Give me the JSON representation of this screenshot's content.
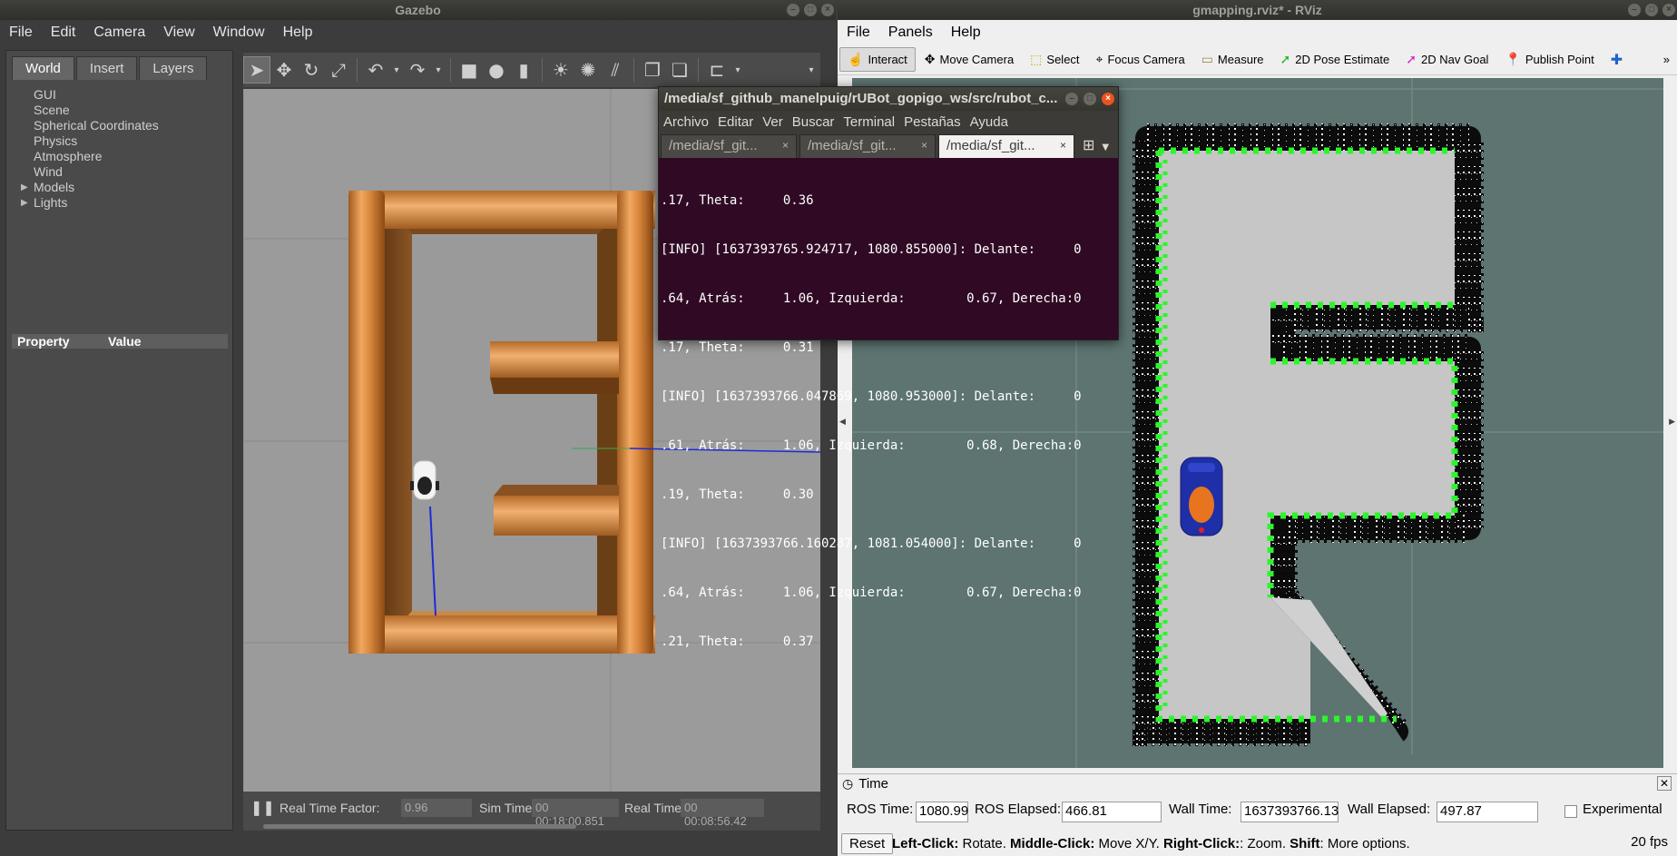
{
  "gazebo": {
    "title": "Gazebo",
    "menu": [
      "File",
      "Edit",
      "Camera",
      "View",
      "Window",
      "Help"
    ],
    "tabs": [
      "World",
      "Insert",
      "Layers"
    ],
    "tree": [
      "GUI",
      "Scene",
      "Spherical Coordinates",
      "Physics",
      "Atmosphere",
      "Wind",
      "Models",
      "Lights"
    ],
    "property_header": [
      "Property",
      "Value"
    ],
    "bottom": {
      "rtf_label": "Real Time Factor:",
      "rtf_value": "0.96",
      "sim_label": "Sim Time:",
      "sim_value": "00 00:18:00.851",
      "real_label": "Real Time:",
      "real_value": "00 00:08:56.42"
    }
  },
  "rviz": {
    "title": "gmapping.rviz* - RViz",
    "menu": [
      "File",
      "Panels",
      "Help"
    ],
    "tools": [
      {
        "label": "Interact",
        "icon": "hand-icon"
      },
      {
        "label": "Move Camera",
        "icon": "move-camera-icon"
      },
      {
        "label": "Select",
        "icon": "select-box-icon"
      },
      {
        "label": "Focus Camera",
        "icon": "focus-camera-icon"
      },
      {
        "label": "Measure",
        "icon": "ruler-icon"
      },
      {
        "label": "2D Pose Estimate",
        "icon": "pose-arrow-icon"
      },
      {
        "label": "2D Nav Goal",
        "icon": "nav-goal-icon"
      },
      {
        "label": "Publish Point",
        "icon": "map-pin-icon"
      }
    ],
    "time_panel": {
      "title": "Time",
      "ros_time_label": "ROS Time:",
      "ros_time_value": "1080.99",
      "ros_elapsed_label": "ROS Elapsed:",
      "ros_elapsed_value": "466.81",
      "wall_time_label": "Wall Time:",
      "wall_time_value": "1637393766.13",
      "wall_elapsed_label": "Wall Elapsed:",
      "wall_elapsed_value": "497.87",
      "experimental_label": "Experimental",
      "reset_label": "Reset",
      "hint_b1": "Left-Click:",
      "hint_t1": " Rotate. ",
      "hint_b2": "Middle-Click:",
      "hint_t2": " Move X/Y. ",
      "hint_b3": "Right-Click:",
      "hint_t3": ": Zoom. ",
      "hint_b4": "Shift",
      "hint_t4": ": More options.",
      "fps": "20 fps"
    }
  },
  "terminal": {
    "title": "/media/sf_github_manelpuig/rUBot_gopigo_ws/src/rubot_c...",
    "menu": [
      "Archivo",
      "Editar",
      "Ver",
      "Buscar",
      "Terminal",
      "Pestañas",
      "Ayuda"
    ],
    "tabs": [
      "/media/sf_git...",
      "/media/sf_git...",
      "/media/sf_git..."
    ],
    "lines": [
      ".17, Theta:     0.36",
      "[INFO] [1637393765.924717, 1080.855000]: Delante:     0",
      ".64, Atrás:     1.06, Izquierda:        0.67, Derecha:0",
      ".17, Theta:     0.31",
      "[INFO] [1637393766.047869, 1080.953000]: Delante:     0",
      ".61, Atrás:     1.06, Izquierda:        0.68, Derecha:0",
      ".19, Theta:     0.30",
      "[INFO] [1637393766.160287, 1081.054000]: Delante:     0",
      ".64, Atrás:     1.06, Izquierda:        0.67, Derecha:0",
      ".21, Theta:     0.37"
    ]
  }
}
